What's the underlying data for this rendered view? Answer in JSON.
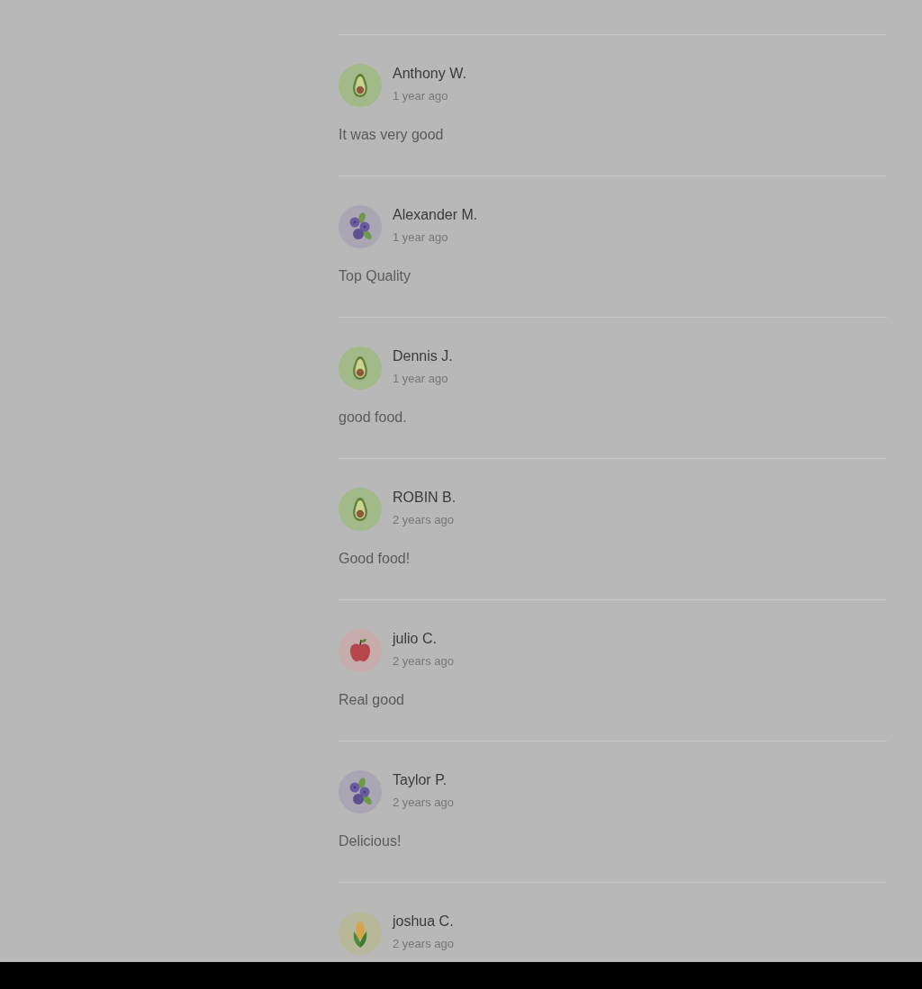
{
  "reviews": [
    {
      "kind": "avocado",
      "name": "Anthony W.",
      "time": "1 year ago",
      "comment": "It was very good"
    },
    {
      "kind": "berries",
      "name": "Alexander M.",
      "time": "1 year ago",
      "comment": "Top Quality"
    },
    {
      "kind": "avocado",
      "name": "Dennis J.",
      "time": "1 year ago",
      "comment": "good food."
    },
    {
      "kind": "avocado",
      "name": "ROBIN B.",
      "time": "2 years ago",
      "comment": "Good food!"
    },
    {
      "kind": "apple",
      "name": "julio C.",
      "time": "2 years ago",
      "comment": "Real good"
    },
    {
      "kind": "berries",
      "name": "Taylor P.",
      "time": "2 years ago",
      "comment": "Delicious!"
    },
    {
      "kind": "corn",
      "name": "joshua C.",
      "time": "2 years ago"
    }
  ]
}
